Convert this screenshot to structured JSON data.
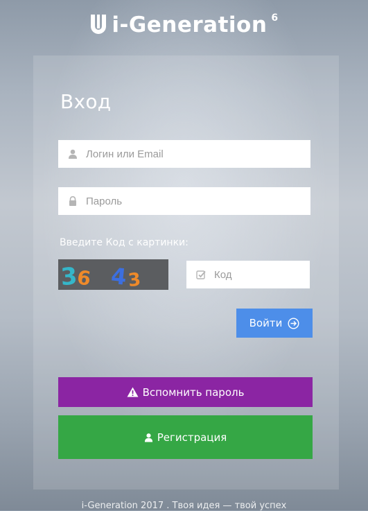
{
  "brand": {
    "name": "i-Generation",
    "version": "6"
  },
  "form": {
    "title": "Вход",
    "login_placeholder": "Логин или Email",
    "password_placeholder": "Пароль",
    "captcha_label": "Введите Код с картинки:",
    "captcha_text": "3643",
    "code_placeholder": "Код",
    "login_button": "Войти"
  },
  "actions": {
    "remind_password": "Вспомнить пароль",
    "register": "Регистрация"
  },
  "footer": {
    "text": "i-Generation 2017 . Твоя идея — твой успех"
  },
  "colors": {
    "login_button": "#4d8ee9",
    "remind_button": "#8b25a3",
    "register_button": "#35a745",
    "captcha_bg": "#5b5d60"
  },
  "icons": {
    "logo": "u-logo-icon",
    "login_field": "user-icon",
    "password_field": "lock-icon",
    "code_field": "check-square-icon",
    "login_button": "arrow-circle-right-icon",
    "remind_button": "warning-icon",
    "register_button": "user-icon"
  }
}
